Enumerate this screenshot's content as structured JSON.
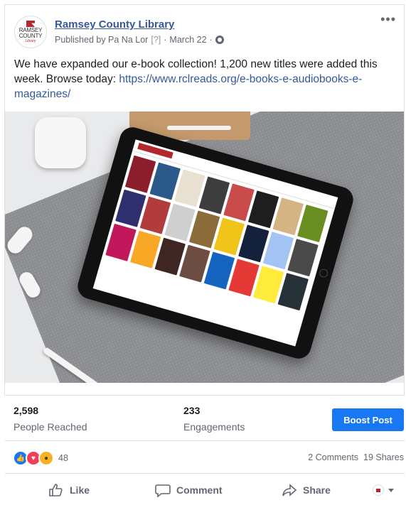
{
  "post": {
    "page_name": "Ramsey County Library",
    "published_by": "Published by Pa Na Lor",
    "help_marker": "[?]",
    "date": "March 22",
    "text": "We have expanded our e-book collection! 1,200 new titles were added this week. Browse today: ",
    "link": "https://www.rclreads.org/e-books-e-audiobooks-e-magazines/",
    "logo_lines": [
      "RAMSEY",
      "COUNTY",
      "Library"
    ]
  },
  "tablet_screen": {
    "app_title": "RAMSEY COUNTY",
    "cover_colors": [
      "#8c1d2b",
      "#2b5a8a",
      "#e8e0d0",
      "#3d3d3d",
      "#c94b4b",
      "#1e1e1e",
      "#d4b483",
      "#6b8e23",
      "#2f2f6f",
      "#b23b3b",
      "#cfcfcf",
      "#8a6d3b",
      "#f0c419",
      "#14213d",
      "#a3c4f3",
      "#4a4a4a",
      "#c2185b",
      "#f9a825",
      "#3e2723",
      "#6d4c41",
      "#1565c0",
      "#e53935",
      "#ffeb3b",
      "#263238"
    ]
  },
  "stats": {
    "reached_value": "2,598",
    "reached_label": "People Reached",
    "engagements_value": "233",
    "engagements_label": "Engagements",
    "boost_label": "Boost Post"
  },
  "reactions": {
    "count": "48",
    "comments": "2 Comments",
    "shares": "19 Shares"
  },
  "actions": {
    "like": "Like",
    "comment": "Comment",
    "share": "Share"
  }
}
